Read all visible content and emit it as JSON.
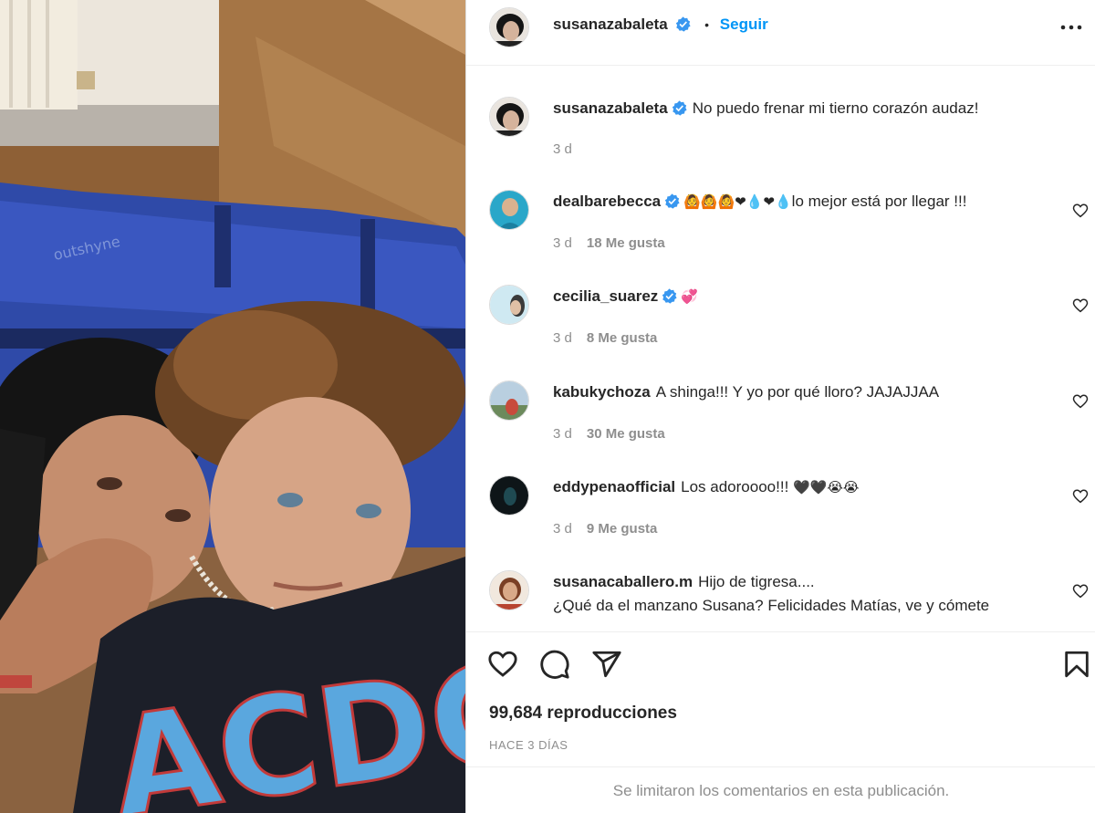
{
  "post": {
    "author": "susanazabaleta",
    "follow_label": "Seguir",
    "dot": "•",
    "caption": "No puedo frenar mi tierno corazón audaz!",
    "caption_time": "3 d",
    "views": "99,684 reproducciones",
    "posted": "HACE 3 DÍAS",
    "comments_limited": "Se limitaron los comentarios en esta publicación."
  },
  "comments": [
    {
      "user": "dealbarebecca",
      "verified": true,
      "text": "lo mejor está por llegar !!!",
      "emoji_prefix": "🙆🙆🙆❤💧❤💧",
      "time": "3 d",
      "likes": "18 Me gusta"
    },
    {
      "user": "cecilia_suarez",
      "verified": true,
      "text": "",
      "emoji_prefix": "💞",
      "time": "3 d",
      "likes": "8 Me gusta"
    },
    {
      "user": "kabukychoza",
      "verified": false,
      "text": "A shinga!!! Y yo por qué lloro? JAJAJJAA",
      "emoji_prefix": "",
      "time": "3 d",
      "likes": "30 Me gusta"
    },
    {
      "user": "eddypenaofficial",
      "verified": false,
      "text": "Los adoroooo!!!",
      "emoji_suffix": "🖤🖤😭😭",
      "time": "3 d",
      "likes": "9 Me gusta"
    },
    {
      "user": "susanacaballero.m",
      "verified": false,
      "text": "Hijo de tigresa....",
      "line2": "¿Qué da el manzano Susana? Felicidades Matías, ve y cómete",
      "time": "",
      "likes": ""
    }
  ],
  "icons": {
    "verified": "verified-badge-icon",
    "more": "more-options-icon",
    "like": "heart-icon",
    "comment": "comment-bubble-icon",
    "share": "paper-plane-icon",
    "save": "bookmark-icon"
  },
  "colors": {
    "link": "#0095f6",
    "verified": "#3897f0",
    "muted": "#8e8e8e"
  }
}
